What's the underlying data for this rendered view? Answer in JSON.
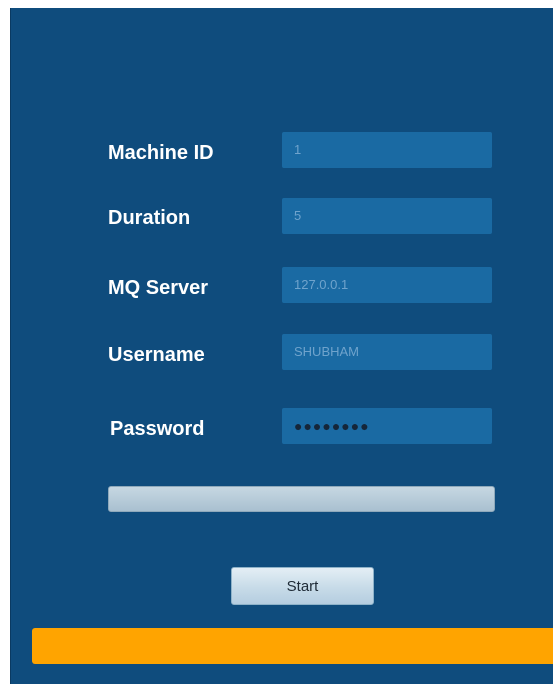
{
  "form": {
    "machine_id": {
      "label": "Machine ID",
      "value": "1"
    },
    "duration": {
      "label": "Duration",
      "value": "5"
    },
    "mq_server": {
      "label": "MQ Server",
      "value": "127.0.0.1"
    },
    "username": {
      "label": "Username",
      "value": "SHUBHAM"
    },
    "password": {
      "label": "Password",
      "value": "●●●●●●●●"
    }
  },
  "progress": {
    "fraction": 0
  },
  "actions": {
    "start_label": "Start"
  },
  "colors": {
    "background": "#0f4c7d",
    "field": "#1a6aa3",
    "status_bar": "#ffa400"
  }
}
